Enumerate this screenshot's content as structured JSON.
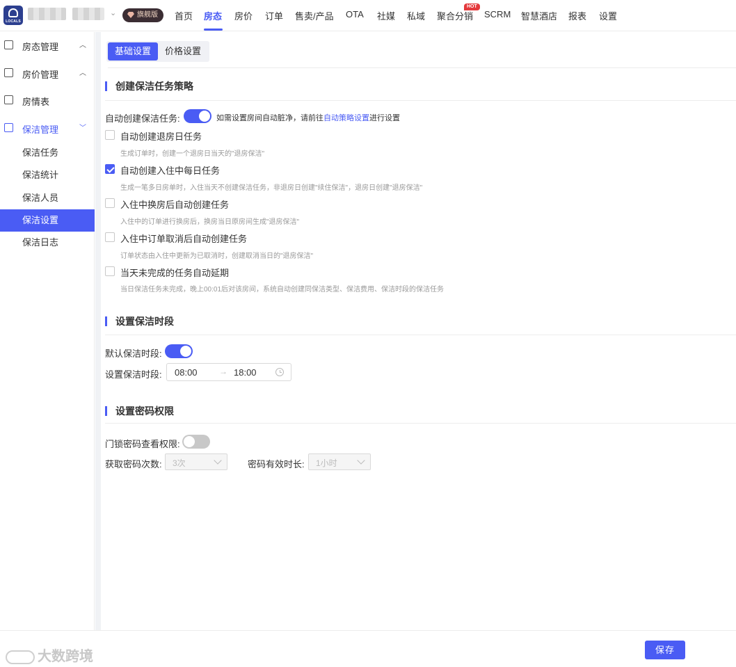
{
  "brand": {
    "logo_text": "LOCALS",
    "edition_label": "旗舰版"
  },
  "nav": {
    "items": [
      "首页",
      "房态",
      "房价",
      "订单",
      "售卖/产品",
      "OTA",
      "社媒",
      "私域",
      "聚合分销",
      "SCRM",
      "智慧酒店",
      "报表",
      "设置"
    ],
    "active": "房态",
    "hot_badge": "HOT"
  },
  "sidebar": {
    "groups": [
      {
        "label": "房态管理",
        "icon": "home-icon",
        "expanded": false
      },
      {
        "label": "房价管理",
        "icon": "price-house-icon",
        "expanded": false
      },
      {
        "label": "房情表",
        "icon": "clipboard-icon"
      },
      {
        "label": "保洁管理",
        "icon": "cleaning-icon",
        "expanded": true
      }
    ],
    "sub_items": [
      "保洁任务",
      "保洁统计",
      "保洁人员",
      "保洁设置",
      "保洁日志"
    ],
    "active_sub": "保洁设置"
  },
  "tabs": {
    "items": [
      "基础设置",
      "价格设置"
    ],
    "active": "基础设置"
  },
  "cleaning_strategy": {
    "title": "创建保洁任务策略",
    "auto_create_label": "自动创建保洁任务:",
    "auto_create_on": true,
    "hint_prefix": "如需设置房间自动脏净，请前往",
    "hint_link": "自动策略设置",
    "hint_suffix": "进行设置",
    "options": [
      {
        "label": "自动创建退房日任务",
        "checked": false,
        "desc": "生成订单时，创建一个退房日当天的\"退房保洁\""
      },
      {
        "label": "自动创建入住中每日任务",
        "checked": true,
        "desc": "生成一笔多日房单时，入住当天不创建保洁任务，非退房日创建\"续住保洁\"，退房日创建\"退房保洁\""
      },
      {
        "label": "入住中换房后自动创建任务",
        "checked": false,
        "desc": "入住中的订单进行换房后，换房当日原房间生成\"退房保洁\""
      },
      {
        "label": "入住中订单取消后自动创建任务",
        "checked": false,
        "desc": "订单状态由入住中更新为已取消时，创建取消当日的\"退房保洁\""
      },
      {
        "label": "当天未完成的任务自动延期",
        "checked": false,
        "desc": "当日保洁任务未完成，晚上00:01后对该房间，系统自动创建同保洁类型、保洁费用、保洁时段的保洁任务"
      }
    ]
  },
  "time_slot": {
    "title": "设置保洁时段",
    "default_label": "默认保洁时段:",
    "default_on": true,
    "range_label": "设置保洁时段:",
    "start": "08:00",
    "end": "18:00",
    "arrow": "→"
  },
  "password": {
    "title": "设置密码权限",
    "view_label": "门锁密码查看权限:",
    "view_on": false,
    "count_label": "获取密码次数:",
    "count_value": "3次",
    "duration_label": "密码有效时长:",
    "duration_value": "1小时"
  },
  "footer": {
    "save_label": "保存",
    "watermark": "大数跨境"
  },
  "colors": {
    "accent": "#4a5cf4",
    "hot": "#e4393c",
    "edition_bg": "#3b2d33"
  }
}
